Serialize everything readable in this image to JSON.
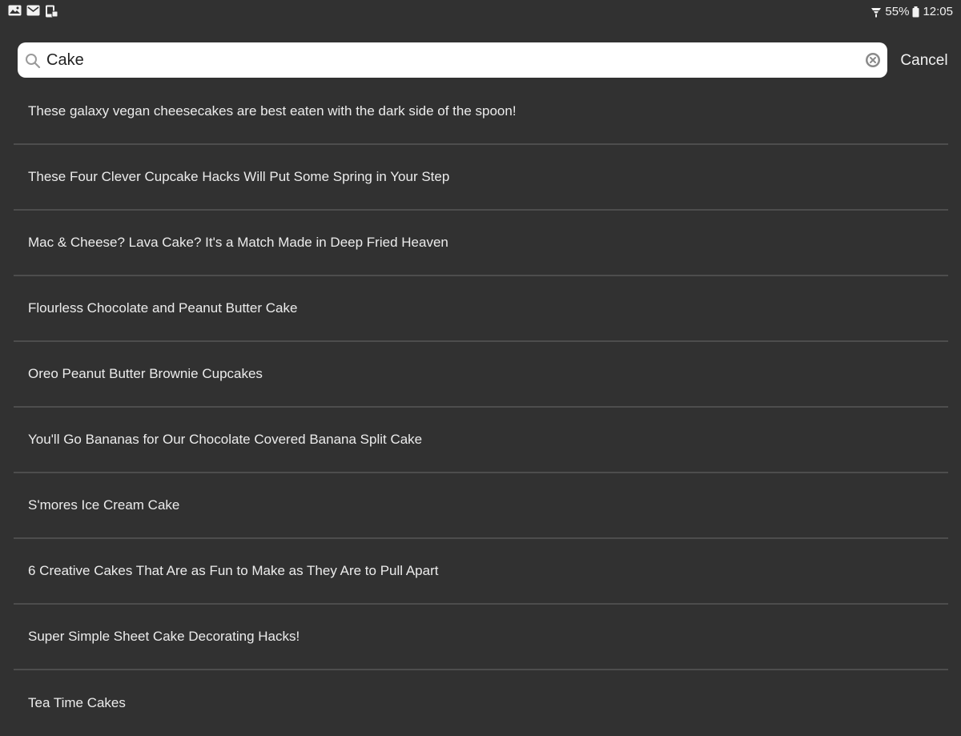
{
  "status_bar": {
    "left_icons": [
      "gallery-icon",
      "mail-icon",
      "phone-icon"
    ],
    "battery_percent": "55%",
    "time": "12:05"
  },
  "search": {
    "value": "Cake",
    "placeholder": "",
    "cancel_label": "Cancel"
  },
  "results": [
    "These galaxy vegan cheesecakes are best eaten with the dark side of the spoon!",
    "These Four Clever Cupcake Hacks Will Put Some Spring in Your Step",
    "Mac & Cheese? Lava Cake? It's a Match Made in Deep Fried Heaven",
    "Flourless Chocolate and Peanut Butter Cake",
    "Oreo Peanut Butter Brownie Cupcakes",
    "You'll Go Bananas for Our Chocolate Covered Banana Split Cake",
    "S'mores Ice Cream Cake",
    "6 Creative Cakes That Are as Fun to Make as They Are to Pull Apart",
    "Super Simple Sheet Cake Decorating Hacks!",
    "Tea Time Cakes"
  ],
  "colors": {
    "background": "#313131",
    "divider": "#4d4d4d",
    "search_box": "#ffffff",
    "text": "#ececec"
  }
}
